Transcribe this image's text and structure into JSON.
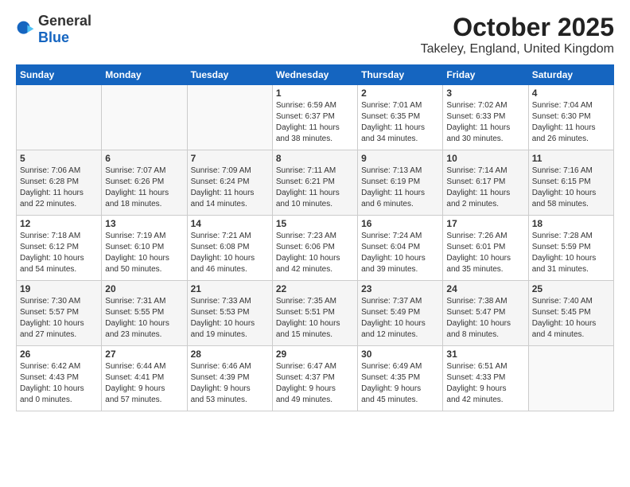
{
  "header": {
    "logo_general": "General",
    "logo_blue": "Blue",
    "month": "October 2025",
    "location": "Takeley, England, United Kingdom"
  },
  "weekdays": [
    "Sunday",
    "Monday",
    "Tuesday",
    "Wednesday",
    "Thursday",
    "Friday",
    "Saturday"
  ],
  "weeks": [
    [
      {
        "day": "",
        "content": ""
      },
      {
        "day": "",
        "content": ""
      },
      {
        "day": "",
        "content": ""
      },
      {
        "day": "1",
        "content": "Sunrise: 6:59 AM\nSunset: 6:37 PM\nDaylight: 11 hours\nand 38 minutes."
      },
      {
        "day": "2",
        "content": "Sunrise: 7:01 AM\nSunset: 6:35 PM\nDaylight: 11 hours\nand 34 minutes."
      },
      {
        "day": "3",
        "content": "Sunrise: 7:02 AM\nSunset: 6:33 PM\nDaylight: 11 hours\nand 30 minutes."
      },
      {
        "day": "4",
        "content": "Sunrise: 7:04 AM\nSunset: 6:30 PM\nDaylight: 11 hours\nand 26 minutes."
      }
    ],
    [
      {
        "day": "5",
        "content": "Sunrise: 7:06 AM\nSunset: 6:28 PM\nDaylight: 11 hours\nand 22 minutes."
      },
      {
        "day": "6",
        "content": "Sunrise: 7:07 AM\nSunset: 6:26 PM\nDaylight: 11 hours\nand 18 minutes."
      },
      {
        "day": "7",
        "content": "Sunrise: 7:09 AM\nSunset: 6:24 PM\nDaylight: 11 hours\nand 14 minutes."
      },
      {
        "day": "8",
        "content": "Sunrise: 7:11 AM\nSunset: 6:21 PM\nDaylight: 11 hours\nand 10 minutes."
      },
      {
        "day": "9",
        "content": "Sunrise: 7:13 AM\nSunset: 6:19 PM\nDaylight: 11 hours\nand 6 minutes."
      },
      {
        "day": "10",
        "content": "Sunrise: 7:14 AM\nSunset: 6:17 PM\nDaylight: 11 hours\nand 2 minutes."
      },
      {
        "day": "11",
        "content": "Sunrise: 7:16 AM\nSunset: 6:15 PM\nDaylight: 10 hours\nand 58 minutes."
      }
    ],
    [
      {
        "day": "12",
        "content": "Sunrise: 7:18 AM\nSunset: 6:12 PM\nDaylight: 10 hours\nand 54 minutes."
      },
      {
        "day": "13",
        "content": "Sunrise: 7:19 AM\nSunset: 6:10 PM\nDaylight: 10 hours\nand 50 minutes."
      },
      {
        "day": "14",
        "content": "Sunrise: 7:21 AM\nSunset: 6:08 PM\nDaylight: 10 hours\nand 46 minutes."
      },
      {
        "day": "15",
        "content": "Sunrise: 7:23 AM\nSunset: 6:06 PM\nDaylight: 10 hours\nand 42 minutes."
      },
      {
        "day": "16",
        "content": "Sunrise: 7:24 AM\nSunset: 6:04 PM\nDaylight: 10 hours\nand 39 minutes."
      },
      {
        "day": "17",
        "content": "Sunrise: 7:26 AM\nSunset: 6:01 PM\nDaylight: 10 hours\nand 35 minutes."
      },
      {
        "day": "18",
        "content": "Sunrise: 7:28 AM\nSunset: 5:59 PM\nDaylight: 10 hours\nand 31 minutes."
      }
    ],
    [
      {
        "day": "19",
        "content": "Sunrise: 7:30 AM\nSunset: 5:57 PM\nDaylight: 10 hours\nand 27 minutes."
      },
      {
        "day": "20",
        "content": "Sunrise: 7:31 AM\nSunset: 5:55 PM\nDaylight: 10 hours\nand 23 minutes."
      },
      {
        "day": "21",
        "content": "Sunrise: 7:33 AM\nSunset: 5:53 PM\nDaylight: 10 hours\nand 19 minutes."
      },
      {
        "day": "22",
        "content": "Sunrise: 7:35 AM\nSunset: 5:51 PM\nDaylight: 10 hours\nand 15 minutes."
      },
      {
        "day": "23",
        "content": "Sunrise: 7:37 AM\nSunset: 5:49 PM\nDaylight: 10 hours\nand 12 minutes."
      },
      {
        "day": "24",
        "content": "Sunrise: 7:38 AM\nSunset: 5:47 PM\nDaylight: 10 hours\nand 8 minutes."
      },
      {
        "day": "25",
        "content": "Sunrise: 7:40 AM\nSunset: 5:45 PM\nDaylight: 10 hours\nand 4 minutes."
      }
    ],
    [
      {
        "day": "26",
        "content": "Sunrise: 6:42 AM\nSunset: 4:43 PM\nDaylight: 10 hours\nand 0 minutes."
      },
      {
        "day": "27",
        "content": "Sunrise: 6:44 AM\nSunset: 4:41 PM\nDaylight: 9 hours\nand 57 minutes."
      },
      {
        "day": "28",
        "content": "Sunrise: 6:46 AM\nSunset: 4:39 PM\nDaylight: 9 hours\nand 53 minutes."
      },
      {
        "day": "29",
        "content": "Sunrise: 6:47 AM\nSunset: 4:37 PM\nDaylight: 9 hours\nand 49 minutes."
      },
      {
        "day": "30",
        "content": "Sunrise: 6:49 AM\nSunset: 4:35 PM\nDaylight: 9 hours\nand 45 minutes."
      },
      {
        "day": "31",
        "content": "Sunrise: 6:51 AM\nSunset: 4:33 PM\nDaylight: 9 hours\nand 42 minutes."
      },
      {
        "day": "",
        "content": ""
      }
    ]
  ]
}
